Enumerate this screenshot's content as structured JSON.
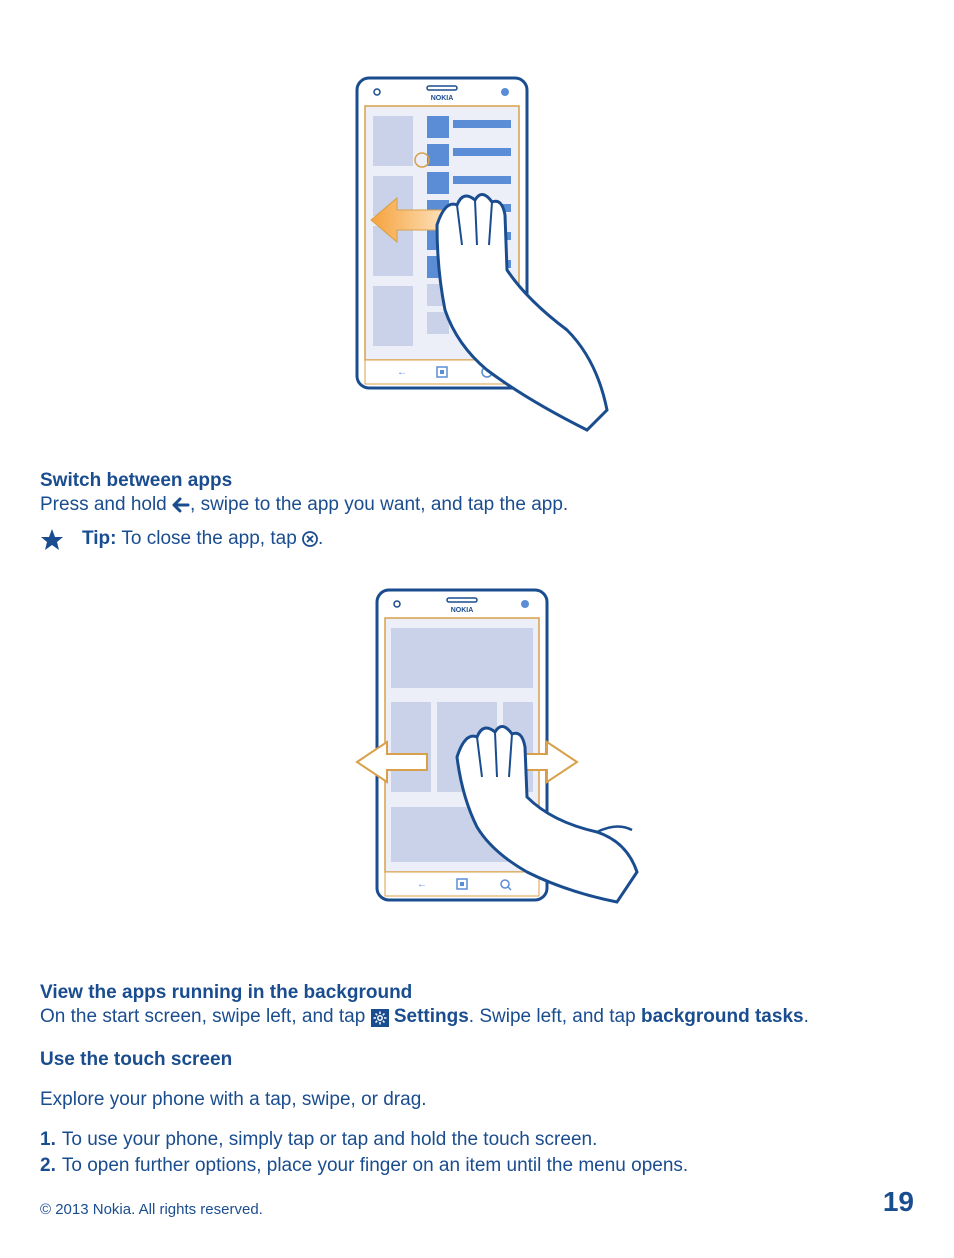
{
  "section1": {
    "heading": "Switch between apps",
    "intro_before": "Press and hold ",
    "intro_after": ", swipe to the app you want, and tap the app.",
    "tip_label": "Tip:",
    "tip_before": " To close the app, tap ",
    "tip_after": "."
  },
  "section2": {
    "heading": "View the apps running in the background",
    "line_before": "On the start screen, swipe left, and tap ",
    "settings_label": "Settings",
    "line_mid": ". Swipe left, and tap ",
    "bg_tasks_label": "background tasks",
    "line_after": "."
  },
  "section3": {
    "heading": "Use the touch screen",
    "intro": "Explore your phone with a tap, swipe, or drag.",
    "items": [
      {
        "num": "1.",
        "text": "To use your phone, simply tap or tap and hold the touch screen."
      },
      {
        "num": "2.",
        "text": "To open further options, place your finger on an item until the menu opens."
      }
    ]
  },
  "footer": {
    "copyright": "© 2013 Nokia. All rights reserved.",
    "page": "19"
  },
  "brand": "NOKIA"
}
